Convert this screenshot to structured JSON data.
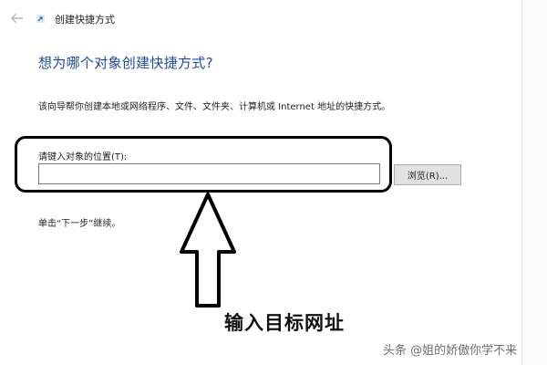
{
  "window": {
    "title": "创建快捷方式"
  },
  "wizard": {
    "heading": "想为哪个对象创建快捷方式?",
    "description": "该向导帮你创建本地或网络程序、文件、文件夹、计算机或 Internet 地址的快捷方式。",
    "location_label": "请键入对象的位置(T):",
    "location_value": "",
    "browse_label": "浏览(R)...",
    "next_hint": "单击“下一步”继续。"
  },
  "annotation": {
    "label": "输入目标网址"
  },
  "watermark": "头条 @姐的娇傲你学不来",
  "icons": {
    "back": "back-arrow-icon",
    "app": "shortcut-icon",
    "annotation_arrow": "up-arrow-icon"
  },
  "colors": {
    "heading": "#1d4b9a",
    "annotation": "#000000",
    "button_bg": "#e1e1e1"
  }
}
